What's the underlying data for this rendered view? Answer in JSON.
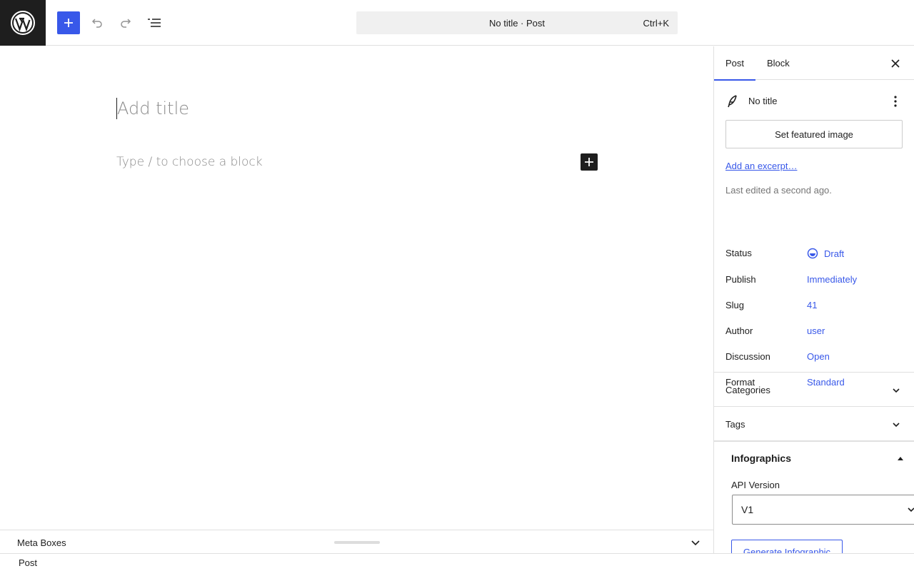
{
  "topbar": {
    "command_title": "No title · Post",
    "command_shortcut": "Ctrl+K"
  },
  "editor": {
    "title_placeholder": "Add title",
    "block_placeholder": "Type / to choose a block"
  },
  "meta_boxes": {
    "label": "Meta Boxes"
  },
  "footer": {
    "breadcrumb": "Post"
  },
  "sidebar": {
    "tabs": [
      {
        "label": "Post"
      },
      {
        "label": "Block"
      }
    ],
    "active_tab": "Post",
    "post_title": "No title",
    "featured_image_button": "Set featured image",
    "excerpt_link": "Add an excerpt…",
    "last_edited": "Last edited a second ago.",
    "rows": [
      {
        "label": "Status",
        "value": "Draft"
      },
      {
        "label": "Publish",
        "value": "Immediately"
      },
      {
        "label": "Slug",
        "value": "41"
      },
      {
        "label": "Author",
        "value": "user"
      },
      {
        "label": "Discussion",
        "value": "Open"
      },
      {
        "label": "Format",
        "value": "Standard"
      }
    ],
    "panels": [
      {
        "label": "Categories"
      },
      {
        "label": "Tags"
      }
    ],
    "infographics": {
      "title": "Infographics",
      "api_label": "API Version",
      "api_value": "V1",
      "generate_button": "Generate Infographic"
    }
  },
  "colors": {
    "accent": "#3858e9",
    "dark": "#1e1e1e",
    "border": "#e0e0e0"
  }
}
